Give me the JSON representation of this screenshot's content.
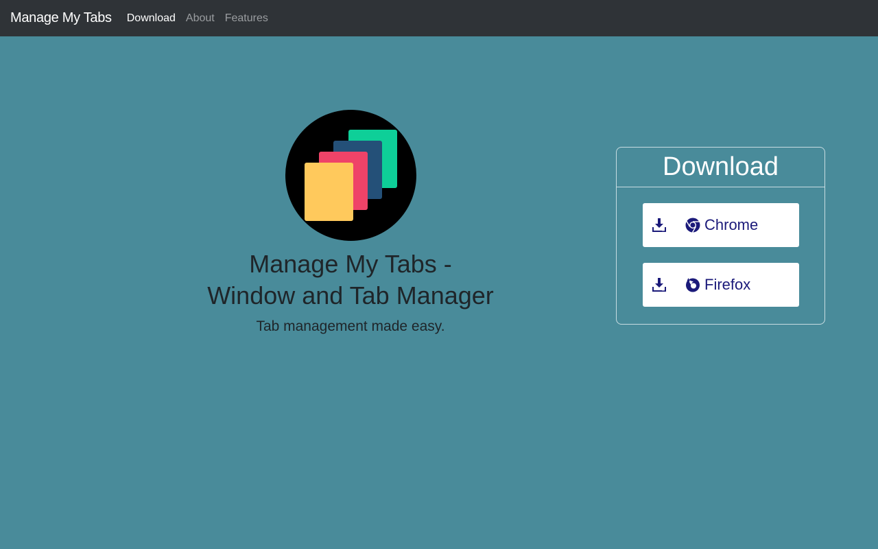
{
  "navbar": {
    "brand": "Manage My Tabs",
    "links": [
      {
        "label": "Download",
        "active": true
      },
      {
        "label": "About",
        "active": false
      },
      {
        "label": "Features",
        "active": false
      }
    ]
  },
  "hero": {
    "title_line1": "Manage My Tabs -",
    "title_line2": "Window and Tab Manager",
    "tagline": "Tab management made easy."
  },
  "download": {
    "heading": "Download",
    "buttons": [
      {
        "label": "Chrome",
        "icon": "chrome-icon"
      },
      {
        "label": "Firefox",
        "icon": "firefox-icon"
      }
    ]
  },
  "colors": {
    "background": "#498b9a",
    "navbar": "#2f3337",
    "button_text": "#1b1a7a",
    "logo_yellow": "#ffc95c",
    "logo_pink": "#ef4368",
    "logo_navy": "#245078",
    "logo_green": "#0ecf98"
  }
}
